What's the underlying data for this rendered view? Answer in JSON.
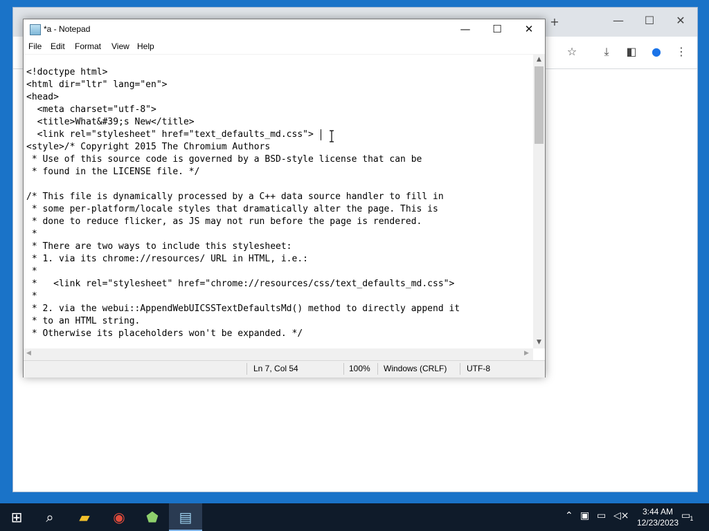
{
  "notepad": {
    "title": "*a - Notepad",
    "menu": [
      "File",
      "Edit",
      "Format",
      "View",
      "Help"
    ],
    "code_lines": [
      "<!doctype html>",
      "<html dir=\"ltr\" lang=\"en\">",
      "<head>",
      "  <meta charset=\"utf-8\">",
      "  <title>What&#39;s New</title>",
      "  <link rel=\"stylesheet\" href=\"text_defaults_md.css\">",
      "<style>/* Copyright 2015 The Chromium Authors",
      " * Use of this source code is governed by a BSD-style license that can be",
      " * found in the LICENSE file. */",
      "",
      "/* This file is dynamically processed by a C++ data source handler to fill in",
      " * some per-platform/locale styles that dramatically alter the page. This is",
      " * done to reduce flicker, as JS may not run before the page is rendered.",
      " *",
      " * There are two ways to include this stylesheet:",
      " * 1. via its chrome://resources/ URL in HTML, i.e.:",
      " *",
      " *   <link rel=\"stylesheet\" href=\"chrome://resources/css/text_defaults_md.css\">",
      " *",
      " * 2. via the webui::AppendWebUICSSTextDefaultsMd() method to directly append it",
      " * to an HTML string.",
      " * Otherwise its placeholders won't be expanded. */"
    ],
    "status": {
      "position": "Ln 7, Col 54",
      "zoom": "100%",
      "line_endings": "Windows (CRLF)",
      "encoding": "UTF-8"
    }
  },
  "taskbar": {
    "time": "3:44 AM",
    "date": "12/23/2023",
    "notification_count": "1"
  }
}
